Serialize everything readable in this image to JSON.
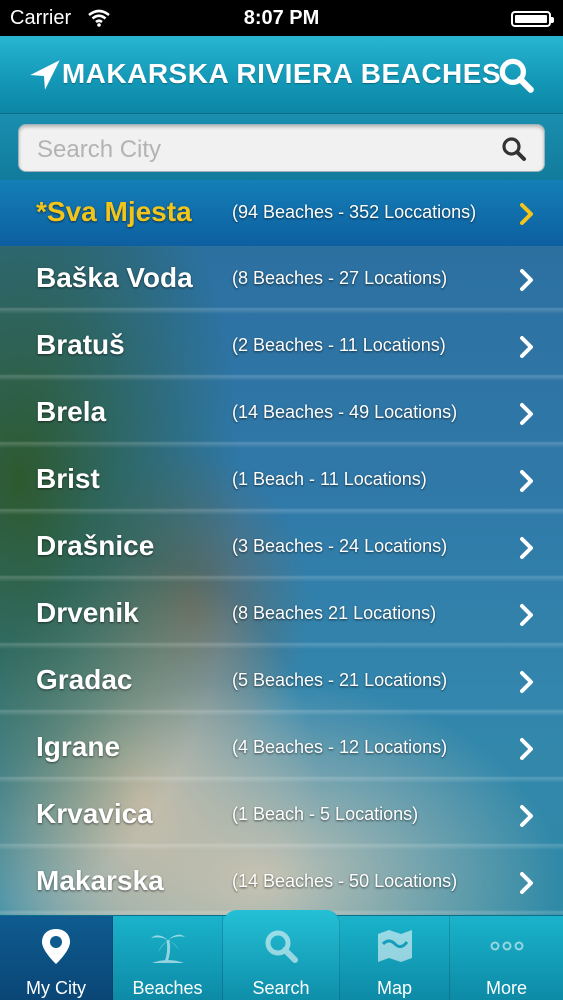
{
  "status_bar": {
    "carrier": "Carrier",
    "time": "8:07 PM"
  },
  "header": {
    "title": "MAKARSKA RIVIERA BEACHES",
    "left_icon": "location-arrow-icon",
    "right_icon": "search-icon"
  },
  "search": {
    "placeholder": "Search City"
  },
  "cities": [
    {
      "name": "*Sva Mjesta",
      "count": "(94 Beaches - 352 Loccations)",
      "highlight": true
    },
    {
      "name": "Baška Voda",
      "count": "(8 Beaches - 27 Locations)"
    },
    {
      "name": "Bratuš",
      "count": "(2 Beaches - 11 Locations)"
    },
    {
      "name": "Brela",
      "count": "(14 Beaches - 49 Locations)"
    },
    {
      "name": "Brist",
      "count": "(1 Beach - 11 Locations)"
    },
    {
      "name": "Drašnice",
      "count": "(3 Beaches - 24 Locations)"
    },
    {
      "name": "Drvenik",
      "count": "(8 Beaches 21 Locations)"
    },
    {
      "name": "Gradac",
      "count": "(5 Beaches - 21 Locations)"
    },
    {
      "name": "Igrane",
      "count": "(4 Beaches - 12 Locations)"
    },
    {
      "name": "Krvavica",
      "count": "(1 Beach - 5 Locations)"
    },
    {
      "name": "Makarska",
      "count": "(14 Beaches - 50 Locations)"
    }
  ],
  "tabs": [
    {
      "label": "My City",
      "icon": "map-pin-icon"
    },
    {
      "label": "Beaches",
      "icon": "palm-tree-icon"
    },
    {
      "label": "Search",
      "icon": "search-icon"
    },
    {
      "label": "Map",
      "icon": "map-icon"
    },
    {
      "label": "More",
      "icon": "more-dots-icon"
    }
  ],
  "colors": {
    "nav": "#1499b8",
    "highlight_name": "#f3c51b",
    "active_tab": "#0f5b8f"
  }
}
